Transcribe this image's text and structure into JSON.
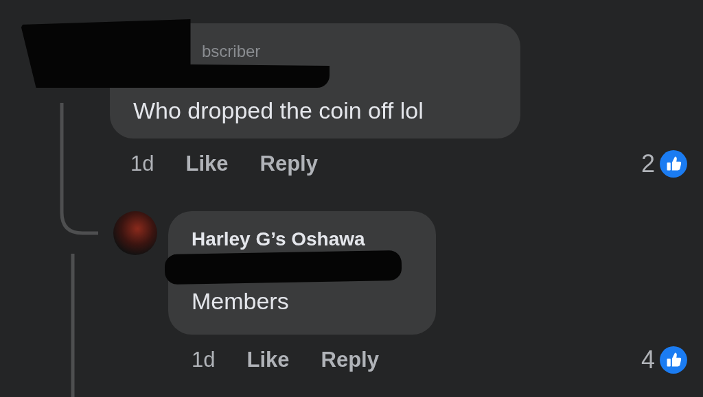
{
  "comments": [
    {
      "badge": "bscriber",
      "redacted": true,
      "text": "Who dropped the coin off lol",
      "time": "1d",
      "actions": [
        "Like",
        "Reply"
      ],
      "reactions": "2"
    },
    {
      "author": "Harley G’s Oshawa",
      "redacted": true,
      "text": "Members",
      "time": "1d",
      "actions": [
        "Like",
        "Reply"
      ],
      "reactions": "4"
    }
  ]
}
